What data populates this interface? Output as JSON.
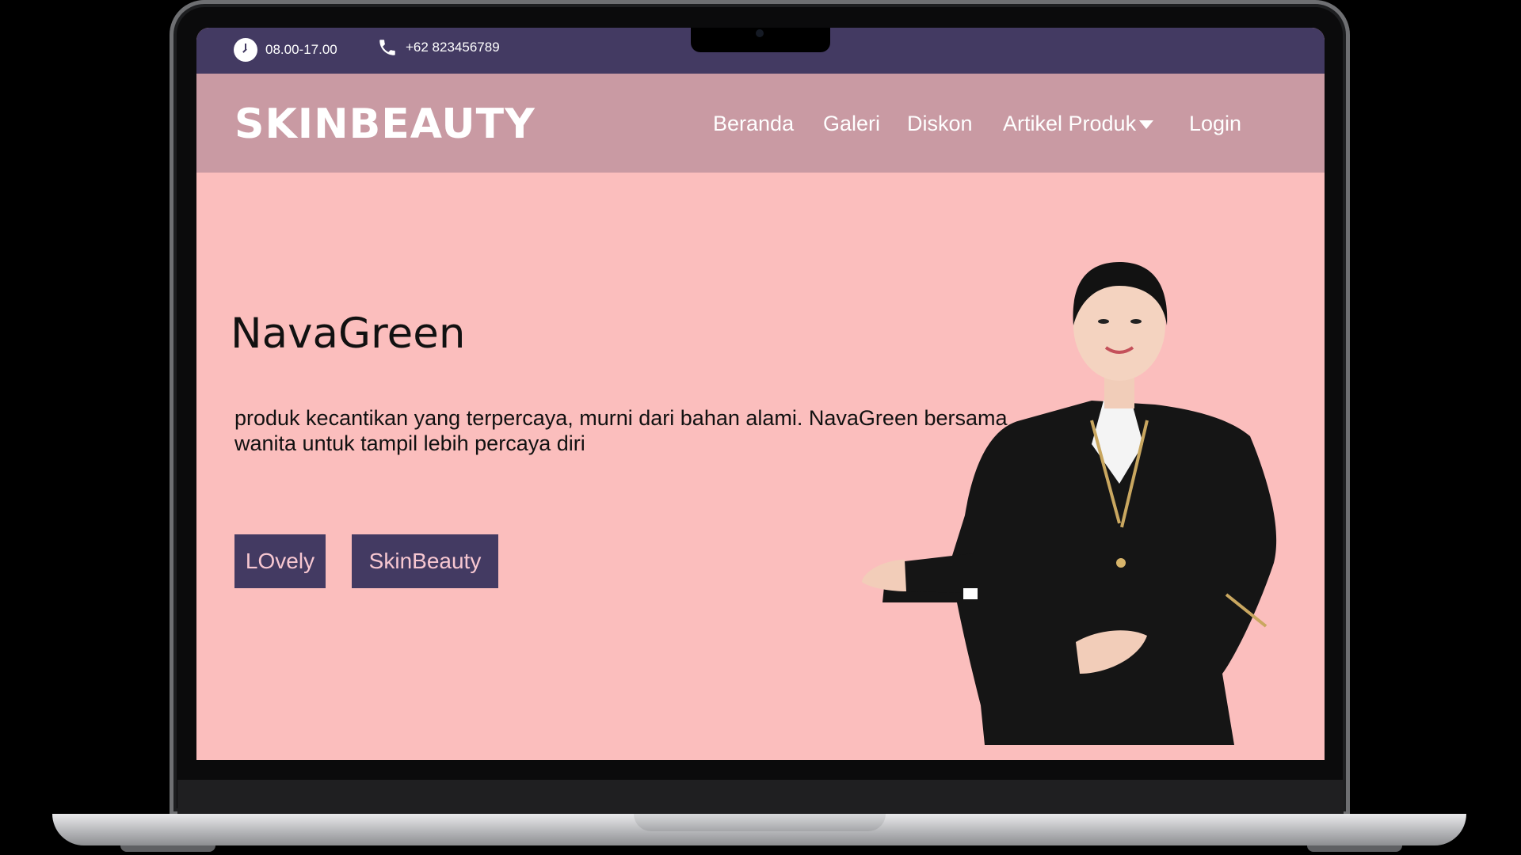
{
  "topbar": {
    "hours": "08.00-17.00",
    "phone": "+62 823456789",
    "icons": [
      "clock-icon",
      "phone-icon"
    ]
  },
  "navbar": {
    "brand": "SKINBEAUTY",
    "items": [
      {
        "label": "Beranda"
      },
      {
        "label": "Galeri"
      },
      {
        "label": "Diskon"
      },
      {
        "label": "Artikel Produk",
        "has_dropdown": true
      },
      {
        "label": "Login"
      }
    ]
  },
  "hero": {
    "title": "NavaGreen",
    "description": "produk kecantikan yang terpercaya, murni dari bahan alami. NavaGreen bersama wanita untuk tampil lebih percaya diri",
    "buttons": [
      {
        "label": "LOvely"
      },
      {
        "label": "SkinBeauty"
      }
    ]
  },
  "colors": {
    "topbar_bg": "#433a62",
    "navbar_bg": "#c99aa3",
    "hero_bg": "#fbbebd",
    "button_bg": "#433a62",
    "button_text": "#f7c7d1"
  }
}
